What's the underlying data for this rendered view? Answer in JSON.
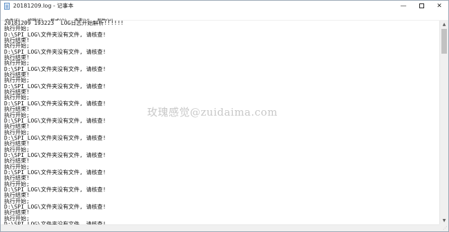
{
  "window": {
    "title": "20181209.log - 记事本",
    "minimize_glyph": "—",
    "maximize_glyph": "",
    "close_glyph": "✕"
  },
  "menu": [
    {
      "label": "文件(F)"
    },
    {
      "label": "编辑(E)"
    },
    {
      "label": "格式(O)"
    },
    {
      "label": "查看(V)"
    },
    {
      "label": "帮助(H)"
    }
  ],
  "editor": {
    "lines": [
      "20181209 193223  LOG日志开始解析!!!!!!",
      "执行开始;",
      "D:\\SPI_LOG\\文件夹没有文件, 请核查!",
      "执行结束!",
      "执行开始;",
      "D:\\SPI_LOG\\文件夹没有文件, 请核查!",
      "执行结束!",
      "执行开始;",
      "D:\\SPI_LOG\\文件夹没有文件, 请核查!",
      "执行结束!",
      "执行开始;",
      "D:\\SPI_LOG\\文件夹没有文件, 请核查!",
      "执行结束!",
      "执行开始;",
      "D:\\SPI_LOG\\文件夹没有文件, 请核查!",
      "执行结束!",
      "执行开始;",
      "D:\\SPI_LOG\\文件夹没有文件, 请核查!",
      "执行结束!",
      "执行开始;",
      "D:\\SPI_LOG\\文件夹没有文件, 请核查!",
      "执行结束!",
      "执行开始;",
      "D:\\SPI_LOG\\文件夹没有文件, 请核查!",
      "执行结束!",
      "执行开始;",
      "D:\\SPI_LOG\\文件夹没有文件, 请核查!",
      "执行结束!",
      "执行开始;",
      "D:\\SPI_LOG\\文件夹没有文件, 请核查!",
      "执行结束!",
      "执行开始;",
      "D:\\SPI_LOG\\文件夹没有文件, 请核查!",
      "执行结束!",
      "执行开始;",
      "D:\\SPI_LOG\\文件夹没有文件, 请核查!"
    ]
  },
  "watermark": "玫瑰感觉@zuidaima.com",
  "icons": {
    "app": "notepad-icon",
    "scroll_up": "scroll-up-arrow-icon",
    "scroll_down": "scroll-down-arrow-icon",
    "resize_grip": "resize-grip-icon"
  }
}
